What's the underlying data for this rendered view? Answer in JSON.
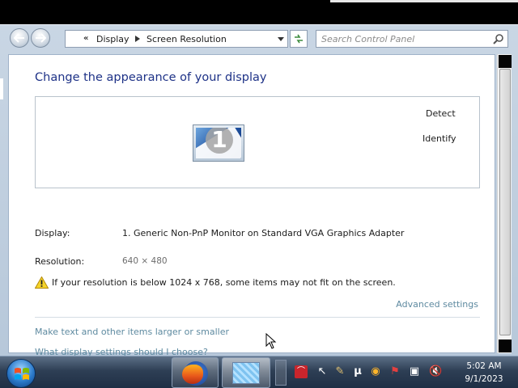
{
  "navigation": {
    "breadcrumb": [
      "Display",
      "Screen Resolution"
    ],
    "search_placeholder": "Search Control Panel"
  },
  "page": {
    "title": "Change the appearance of your display",
    "detect_label": "Detect",
    "identify_label": "Identify",
    "monitor_number": "1",
    "display_label": "Display:",
    "display_value": "1. Generic Non-PnP Monitor on Standard VGA Graphics Adapter",
    "resolution_label": "Resolution:",
    "resolution_value": "640 × 480",
    "warning_text": "If your resolution is below 1024 x 768, some items may not fit on the screen.",
    "advanced_link": "Advanced settings",
    "link_larger": "Make text and other items larger or smaller",
    "link_choose": "What display settings should I choose?"
  },
  "taskbar": {
    "apps": [
      "firefox-icon",
      "control-panel-icon"
    ],
    "clock_time": "5:02 AM",
    "clock_date": "9/1/2023"
  },
  "colors": {
    "title": "#1e3287",
    "link": "#5e8aa0",
    "taskbar": "#2e3f55"
  }
}
